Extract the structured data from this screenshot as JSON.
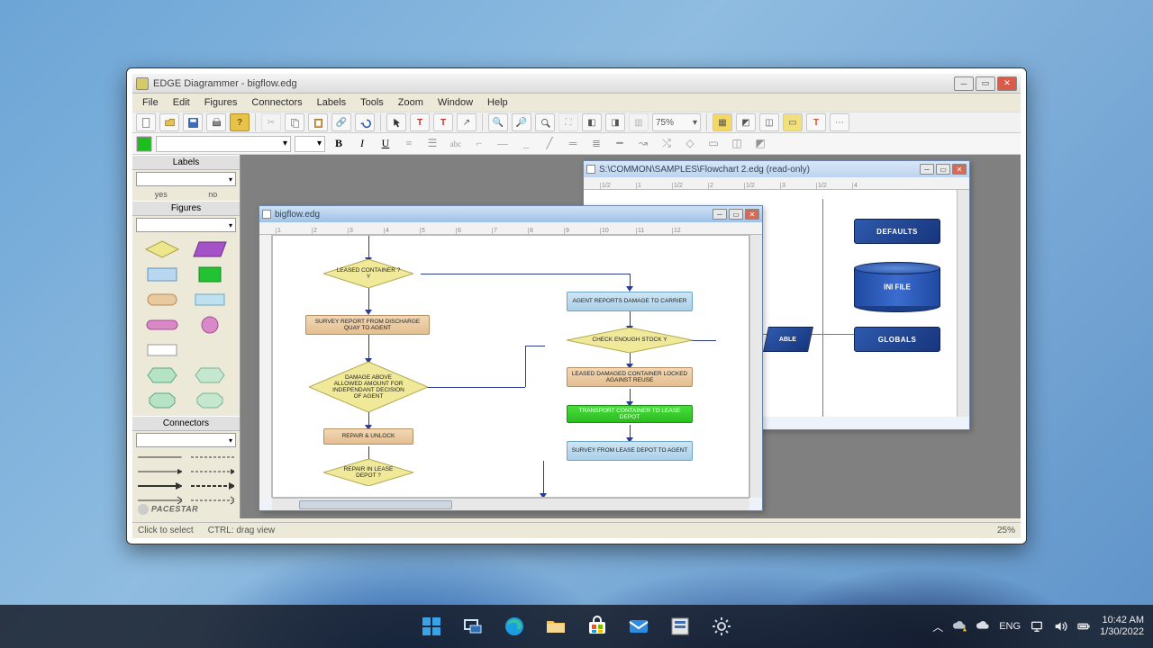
{
  "window": {
    "title": "EDGE Diagrammer - bigflow.edg"
  },
  "menu": {
    "items": [
      "File",
      "Edit",
      "Figures",
      "Connectors",
      "Labels",
      "Tools",
      "Zoom",
      "Window",
      "Help"
    ]
  },
  "toolbar": {
    "zoom": "75%"
  },
  "panels": {
    "labels": {
      "header": "Labels",
      "yes": "yes",
      "no": "no"
    },
    "figures": {
      "header": "Figures"
    },
    "connectors": {
      "header": "Connectors"
    }
  },
  "brand": "PACESTAR",
  "statusbar": {
    "hint": "Click to select",
    "hint2": "CTRL: drag view",
    "zoom": "25%"
  },
  "doc1": {
    "title": "bigflow.edg",
    "nodes": {
      "d1": "LEASED CONTAINER ?   Y",
      "p1": "SURVEY REPORT FROM DISCHARGE QUAY TO AGENT",
      "d2": "DAMAGE ABOVE ALLOWED AMOUNT FOR INDEPENDANT DECISION OF AGENT",
      "p2": "REPAIR & UNLOCK",
      "d3": "REPAIR IN LEASE DEPOT ?",
      "b1": "AGENT REPORTS DAMAGE TO CARRIER",
      "d4": "CHECK ENOUGH STOCK   Y",
      "p3": "LEASED DAMAGED CONTAINER LOCKED AGAINST REUSE",
      "g1": "TRANSPORT CONTAINER TO LEASE DEPOT",
      "b2": "SURVEY FROM LEASE DEPOT TO AGENT"
    }
  },
  "doc2": {
    "title": "S:\\COMMON\\SAMPLES\\Flowchart 2.edg (read-only)",
    "nodes": {
      "defaults": "DEFAULTS",
      "ini": "INI FILE",
      "globals": "GLOBALS",
      "able": "ABLE"
    }
  },
  "systray": {
    "lang": "ENG",
    "time": "10:42 AM",
    "date": "1/30/2022"
  }
}
